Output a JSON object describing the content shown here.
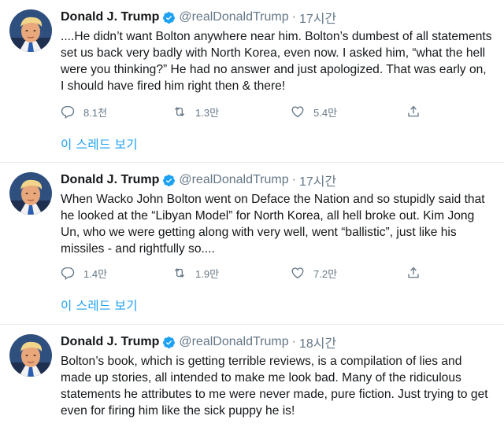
{
  "tweets": [
    {
      "name": "Donald J. Trump",
      "handle": "@realDonaldTrump",
      "separator": "·",
      "time": "17시간",
      "text": "....He didn’t want Bolton anywhere near him. Bolton’s dumbest of all statements set us back very badly with North Korea, even now. I asked him, “what the hell were you thinking?” He had no answer and just apologized. That was early on, I should have fired him right then & there!",
      "replies": "8.1천",
      "retweets": "1.3만",
      "likes": "5.4만",
      "show_thread": "이 스레드 보기"
    },
    {
      "name": "Donald J. Trump",
      "handle": "@realDonaldTrump",
      "separator": "·",
      "time": "17시간",
      "text": "When Wacko John Bolton went on Deface the Nation and so stupidly said that he looked at the “Libyan Model” for North Korea, all hell broke out. Kim Jong Un, who we were getting along with very well, went “ballistic”, just like his missiles - and rightfully so....",
      "replies": "1.4만",
      "retweets": "1.9만",
      "likes": "7.2만",
      "show_thread": "이 스레드 보기"
    },
    {
      "name": "Donald J. Trump",
      "handle": "@realDonaldTrump",
      "separator": "·",
      "time": "18시간",
      "text": "Bolton’s book, which is getting terrible reviews, is a compilation of lies and made up stories, all intended to make me look bad. Many of the ridiculous statements he attributes to me were never made, pure fiction. Just trying to get even for firing him like the sick puppy he is!"
    }
  ],
  "icons": {
    "avatar": "avatar-portrait",
    "verified": "verified-badge-icon",
    "reply": "reply-icon",
    "retweet": "retweet-icon",
    "like": "heart-icon",
    "share": "share-icon"
  },
  "colors": {
    "accent": "#1da1f2",
    "secondary_text": "#657786",
    "primary_text": "#14171a",
    "divider": "#e6ecf0"
  }
}
